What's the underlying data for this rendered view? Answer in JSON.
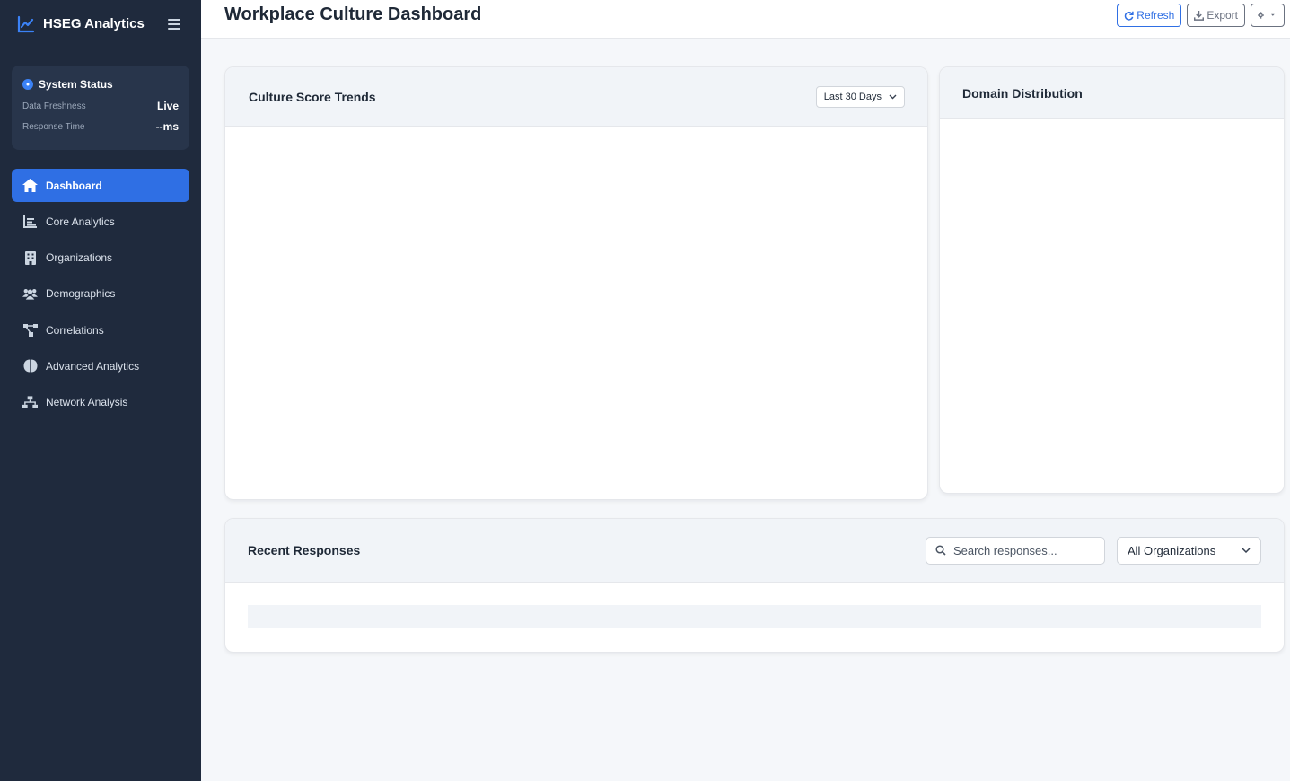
{
  "app": {
    "title": "HSEG Analytics"
  },
  "system_status": {
    "title": "System Status",
    "rows": [
      {
        "label": "Data Freshness",
        "value": "Live"
      },
      {
        "label": "Response Time",
        "value": "--ms"
      }
    ]
  },
  "nav": {
    "items": [
      {
        "label": "Dashboard",
        "icon": "home-icon",
        "active": true
      },
      {
        "label": "Core Analytics",
        "icon": "chart-bar-icon"
      },
      {
        "label": "Organizations",
        "icon": "building-icon"
      },
      {
        "label": "Demographics",
        "icon": "users-icon"
      },
      {
        "label": "Correlations",
        "icon": "diagram-icon"
      },
      {
        "label": "Advanced Analytics",
        "icon": "brain-icon"
      },
      {
        "label": "Network Analysis",
        "icon": "network-icon"
      }
    ]
  },
  "header": {
    "title": "Workplace Culture Dashboard",
    "refresh_label": "Refresh",
    "export_label": "Export",
    "settings_icon": "gear-icon"
  },
  "trends_card": {
    "title": "Culture Score Trends",
    "range_selected": "Last 30 Days"
  },
  "domain_card": {
    "title": "Domain Distribution"
  },
  "responses_card": {
    "title": "Recent Responses",
    "search_placeholder": "Search responses...",
    "org_filter_selected": "All Organizations"
  },
  "colors": {
    "sidebar_bg": "#1f2a3d",
    "accent": "#2f6fe4",
    "page_bg": "#f5f7fa"
  }
}
